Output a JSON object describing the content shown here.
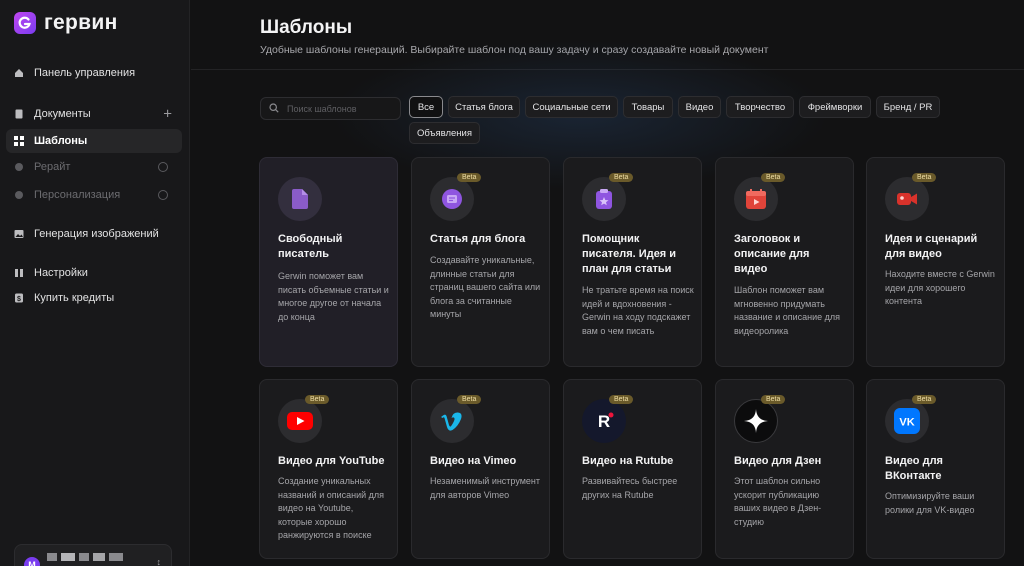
{
  "app": {
    "name": "гервин"
  },
  "sidebar": {
    "items": [
      {
        "label": "Панель управления"
      },
      {
        "label": "Документы",
        "action": "+"
      },
      {
        "label": "Шаблоны"
      },
      {
        "label": "Рерайт"
      },
      {
        "label": "Персонализация"
      },
      {
        "label": "Генерация изображений"
      },
      {
        "label": "Настройки"
      },
      {
        "label": "Купить кредиты"
      }
    ],
    "user": {
      "avatar_letter": "M"
    }
  },
  "header": {
    "title": "Шаблоны",
    "subtitle": "Удобные шаблоны генераций. Выбирайте шаблон под вашу задачу и сразу создавайте новый документ"
  },
  "search": {
    "placeholder": "Поиск шаблонов"
  },
  "filters": [
    {
      "label": "Все"
    },
    {
      "label": "Статья блога"
    },
    {
      "label": "Социальные сети"
    },
    {
      "label": "Товары"
    },
    {
      "label": "Видео"
    },
    {
      "label": "Творчество"
    },
    {
      "label": "Фреймворки"
    },
    {
      "label": "Бренд / PR"
    },
    {
      "label": "Объявления"
    }
  ],
  "cards": [
    {
      "title": "Свободный писатель",
      "desc": "Gerwin поможет вам писать объемные статьи и многое другое от начала до конца",
      "icon": "document-icon"
    },
    {
      "title": "Статья для блога",
      "desc": "Создавайте уникальные, длинные статьи для страниц вашего сайта или блога за считанные минуты",
      "beta": "Beta",
      "icon": "article-icon"
    },
    {
      "title": "Помощник писателя. Идея и план для статьи",
      "desc": "Не тратьте время на поиск идей и вдохновения - Gerwin на ходу подскажет вам о чем писать",
      "beta": "Beta",
      "icon": "idea-icon"
    },
    {
      "title": "Заголовок и описание для видео",
      "desc": "Шаблон поможет вам мгновенно придумать название и описание для видеоролика",
      "beta": "Beta",
      "icon": "video-calendar-icon"
    },
    {
      "title": "Идея и сценарий для видео",
      "desc": "Находите вместе с Gerwin идеи для хорошего контента",
      "beta": "Beta",
      "icon": "camera-icon"
    },
    {
      "title": "Видео для YouTube",
      "desc": "Создание уникальных названий и описаний для видео на Youtube, которые хорошо ранжируются в поиске",
      "beta": "Beta",
      "icon": "youtube-icon"
    },
    {
      "title": "Видео на Vimeo",
      "desc": "Незаменимый инструмент для авторов Vimeo",
      "beta": "Beta",
      "icon": "vimeo-icon"
    },
    {
      "title": "Видео на Rutube",
      "desc": "Развивайтесь быстрее других на Rutube",
      "beta": "Beta",
      "icon": "rutube-icon"
    },
    {
      "title": "Видео для Дзен",
      "desc": "Этот шаблон сильно ускорит публикацию ваших видео в Дзен-студию",
      "beta": "Beta",
      "icon": "dzen-icon"
    },
    {
      "title": "Видео для ВКонтакте",
      "desc": "Оптимизируйте ваши ролики для VK-видео",
      "beta": "Beta",
      "icon": "vk-icon"
    }
  ]
}
